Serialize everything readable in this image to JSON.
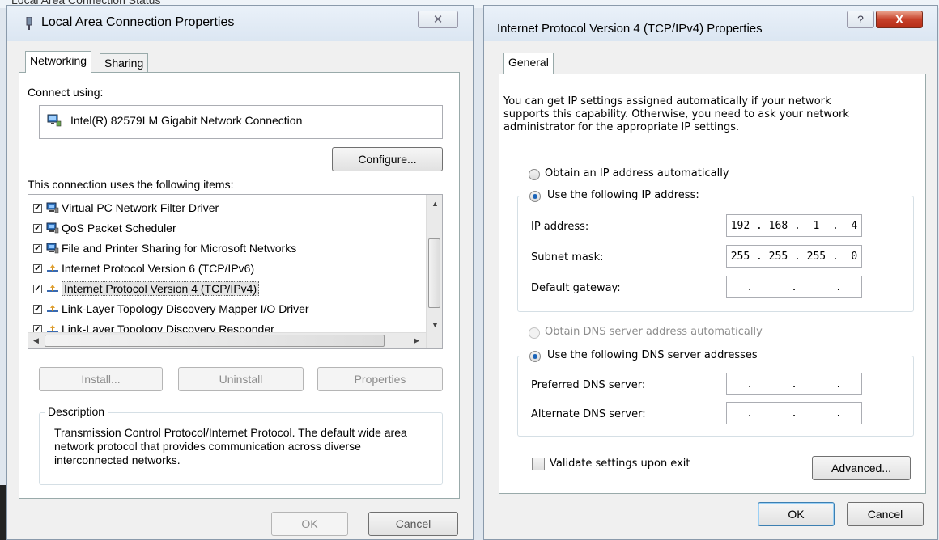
{
  "background": {
    "partial_title": "Local Area Connection Status"
  },
  "left_dialog": {
    "title": "Local Area Connection Properties",
    "close_symbol": "✕",
    "tabs": [
      {
        "label": "Networking",
        "active": true
      },
      {
        "label": "Sharing",
        "active": false
      }
    ],
    "connect_using_label": "Connect using:",
    "adapter_name": "Intel(R) 82579LM Gigabit Network Connection",
    "configure_label": "Configure...",
    "items_label": "This connection uses the following items:",
    "items": [
      {
        "label": "Virtual PC Network Filter Driver",
        "checked": true,
        "icon": "network-computer-icon"
      },
      {
        "label": "QoS Packet Scheduler",
        "checked": true,
        "icon": "network-computer-icon"
      },
      {
        "label": "File and Printer Sharing for Microsoft Networks",
        "checked": true,
        "icon": "network-computer-icon"
      },
      {
        "label": "Internet Protocol Version 6 (TCP/IPv6)",
        "checked": true,
        "icon": "protocol-icon"
      },
      {
        "label": "Internet Protocol Version 4 (TCP/IPv4)",
        "checked": true,
        "icon": "protocol-icon",
        "selected": true
      },
      {
        "label": "Link-Layer Topology Discovery Mapper I/O Driver",
        "checked": true,
        "icon": "protocol-icon"
      },
      {
        "label": "Link-Layer Topology Discovery Responder",
        "checked": true,
        "icon": "protocol-icon"
      }
    ],
    "install_label": "Install...",
    "uninstall_label": "Uninstall",
    "properties_label": "Properties",
    "description_legend": "Description",
    "description_text": "Transmission Control Protocol/Internet Protocol. The default wide area network protocol that provides communication across diverse interconnected networks.",
    "ok_label": "OK",
    "cancel_label": "Cancel"
  },
  "right_dialog": {
    "title": "Internet Protocol Version 4 (TCP/IPv4) Properties",
    "help_symbol": "?",
    "close_symbol": "X",
    "tab_label": "General",
    "intro_text": "You can get IP settings assigned automatically if your network supports this capability. Otherwise, you need to ask your network administrator for the appropriate IP settings.",
    "obtain_ip_label": "Obtain an IP address automatically",
    "use_ip_label": "Use the following IP address:",
    "ip_address_label": "IP address:",
    "ip_address_value": "192 . 168 .  1  .  4",
    "subnet_label": "Subnet mask:",
    "subnet_value": "255 . 255 . 255 .  0",
    "gateway_label": "Default gateway:",
    "gateway_value": " .      .      . ",
    "obtain_dns_label": "Obtain DNS server address automatically",
    "use_dns_label": "Use the following DNS server addresses",
    "preferred_dns_label": "Preferred DNS server:",
    "preferred_dns_value": " .      .      . ",
    "alternate_dns_label": "Alternate DNS server:",
    "alternate_dns_value": " .      .      . ",
    "validate_label": "Validate settings upon exit",
    "advanced_label": "Advanced...",
    "ok_label": "OK",
    "cancel_label": "Cancel"
  },
  "colors": {
    "close_red": "#c7412a",
    "radio_selected": "#1a63b8",
    "accent_border": "#3c7fb1"
  }
}
